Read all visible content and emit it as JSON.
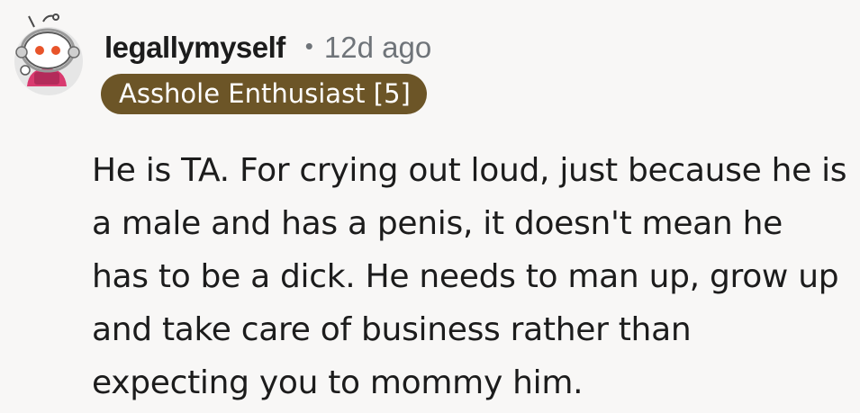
{
  "comment": {
    "author": "legallymyself",
    "separator": "•",
    "time_ago": "12d ago",
    "flair": "Asshole Enthusiast [5]",
    "body": "He is TA. For crying out loud, just because he is a male and has a penis, it doesn't mean he has to be a dick. He needs to man up, grow up and take care of business rather than expecting you to mommy him.",
    "avatar_icon": "snoo-avatar-icon"
  },
  "colors": {
    "background": "#f8f7f6",
    "flair_background": "#6c5527",
    "flair_text": "#ffffff",
    "meta_gray": "#6f7479",
    "text": "#1c1c1c",
    "avatar_accent": "#d93a6f"
  }
}
